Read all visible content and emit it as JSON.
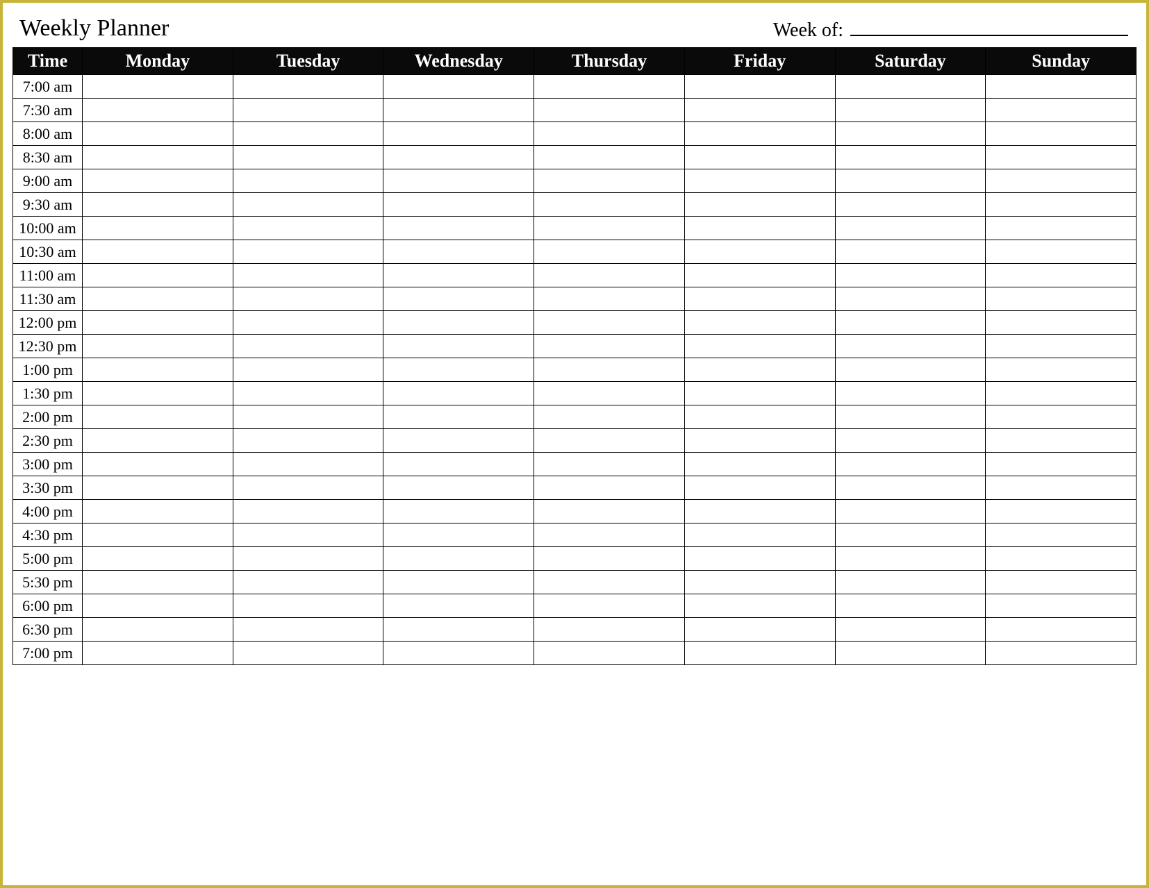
{
  "header": {
    "title": "Weekly Planner",
    "week_of_label": "Week of:",
    "week_of_value": ""
  },
  "table": {
    "columns": [
      "Time",
      "Monday",
      "Tuesday",
      "Wednesday",
      "Thursday",
      "Friday",
      "Saturday",
      "Sunday"
    ],
    "times": [
      "7:00 am",
      "7:30 am",
      "8:00 am",
      "8:30 am",
      "9:00 am",
      "9:30 am",
      "10:00 am",
      "10:30 am",
      "11:00 am",
      "11:30 am",
      "12:00 pm",
      "12:30 pm",
      "1:00 pm",
      "1:30 pm",
      "2:00 pm",
      "2:30 pm",
      "3:00 pm",
      "3:30 pm",
      "4:00 pm",
      "4:30 pm",
      "5:00 pm",
      "5:30 pm",
      "6:00 pm",
      "6:30 pm",
      "7:00 pm"
    ]
  }
}
